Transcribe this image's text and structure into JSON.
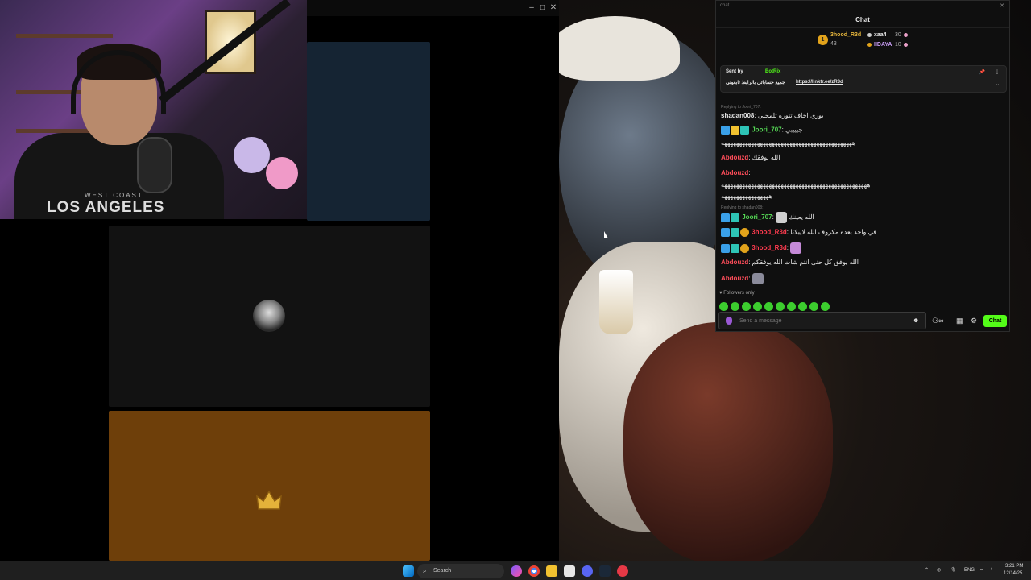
{
  "webcam": {
    "hoodie_text_top": "WEST COAST",
    "hoodie_text_main": "LOS ANGELES"
  },
  "chat": {
    "title": "Chat",
    "leaderboard": [
      {
        "rank": "1",
        "name": "3hood_R3d",
        "points": "43",
        "name_color": "#e8b73c"
      },
      {
        "name": "xaa4",
        "points": "30",
        "name_color": "#eeeeee"
      },
      {
        "name": "IIDAYA",
        "points": "10",
        "name_color": "#c79cf3"
      }
    ],
    "pinned": {
      "sent_by_label": "Sent by",
      "sender": "BotRix",
      "text": "جميع حساباتي بالرابط تابعوني",
      "link": "https://linktr.ee/zR3d"
    },
    "messages": [
      {
        "type": "reply",
        "text": "Replying to Joori_707:"
      },
      {
        "type": "msg",
        "name": "shadan008",
        "color": "#e6e6e6",
        "text": "بوري اخاف تنوره تلمحني"
      },
      {
        "type": "msg",
        "name": "Joori_707",
        "color": "#55d855",
        "text": "جيييبي"
      },
      {
        "type": "msg",
        "name": "",
        "color": "#e6e6e6",
        "text": "ههههههههههههههههههههههههههههههههههههههههههههه"
      },
      {
        "type": "msg",
        "name": "Abdouzd",
        "color": "#ff4d5a",
        "text": "الله يوفقك"
      },
      {
        "type": "msg",
        "name": "Abdouzd",
        "color": "#ff4d5a",
        "text": ""
      },
      {
        "type": "msg",
        "name": "",
        "color": "#e6e6e6",
        "text": "هههههههههههههههههههههههههههههههههههههههههههههههههه"
      },
      {
        "type": "msg",
        "name": "",
        "color": "#e6e6e6",
        "text": "ههههههههههههههههه"
      },
      {
        "type": "reply",
        "text": "Replying to shadan008:"
      },
      {
        "type": "msg",
        "name": "Joori_707",
        "color": "#55d855",
        "text": "الله يعينك"
      },
      {
        "type": "msg",
        "name": "3hood_R3d",
        "color": "#ff3b4f",
        "text": "في واحد بعده مكروف الله لايبلانا"
      },
      {
        "type": "msg",
        "name": "3hood_R3d",
        "color": "#ff3b4f",
        "text": ""
      },
      {
        "type": "msg",
        "name": "Abdouzd",
        "color": "#ff4d5a",
        "text": "الله يوفق كل حتى انتم شات الله يوفقكم"
      },
      {
        "type": "msg",
        "name": "Abdouzd",
        "color": "#ff4d5a",
        "text": ""
      }
    ],
    "followers_only": "Followers only",
    "input_placeholder": "Send a message",
    "send_label": "Chat",
    "accent": "#53fc18"
  },
  "taskbar": {
    "search_label": "Search",
    "lang": "ENG",
    "time": "3:21 PM",
    "date": "12/14/25"
  }
}
